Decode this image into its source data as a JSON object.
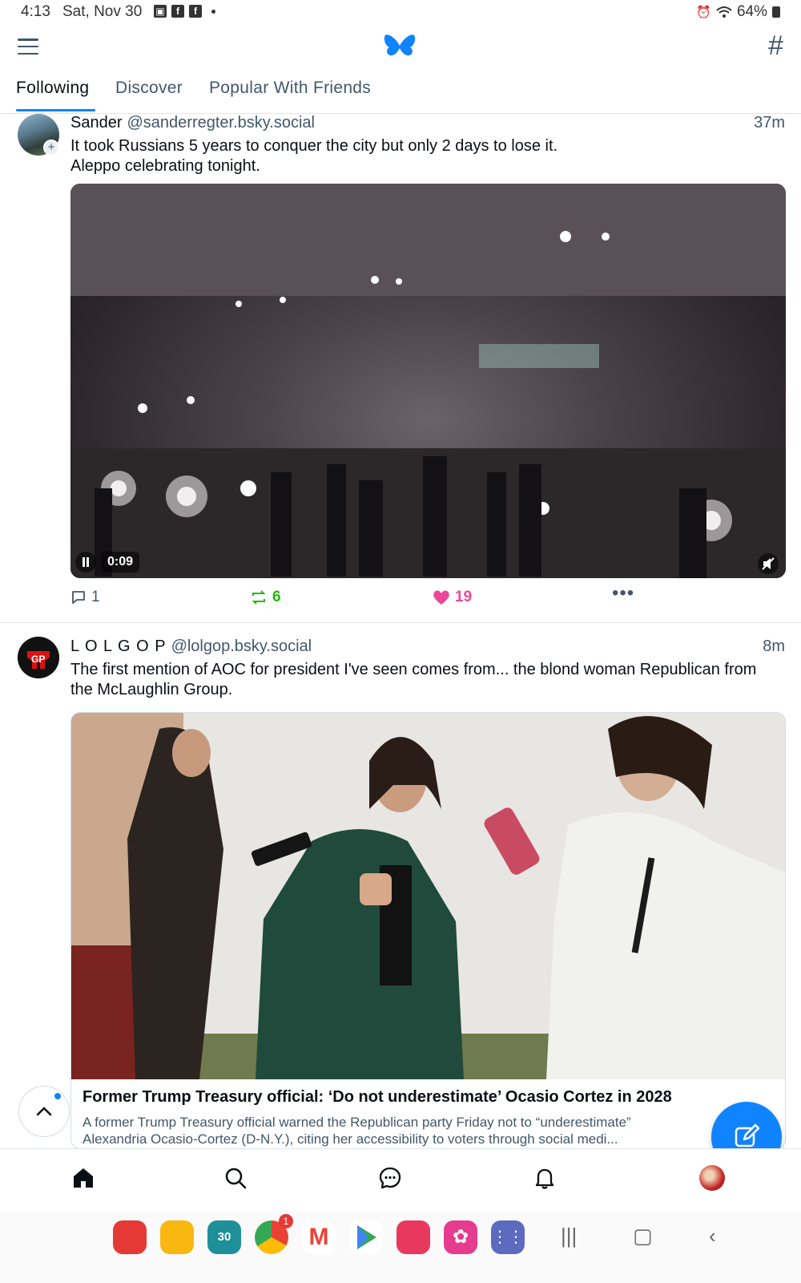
{
  "status_bar": {
    "time": "4:13",
    "date": "Sat, Nov 30",
    "battery": "64%",
    "app_icons": [
      "gallery-icon",
      "facebook-icon",
      "facebook-icon"
    ]
  },
  "header": {
    "logo_icon": "butterfly-icon",
    "menu_icon": "hamburger-menu-icon",
    "feeds_icon": "hashtag-icon"
  },
  "tabs": [
    {
      "label": "Following",
      "active": true
    },
    {
      "label": "Discover",
      "active": false
    },
    {
      "label": "Popular With Friends",
      "active": false
    }
  ],
  "posts": [
    {
      "author_name": "Sander",
      "author_handle": "@sanderregter.bsky.social",
      "time": "37m",
      "text": "It took Russians 5 years to conquer the city but only 2 days to lose it.\nAleppo celebrating tonight.",
      "video_time": "0:09",
      "replies": "1",
      "reposts": "6",
      "likes": "19"
    },
    {
      "author_name": "L O L G O P",
      "author_handle": "@lolgop.bsky.social",
      "time": "8m",
      "text": "The first mention of AOC for president I've seen comes from... the blond woman Republican from the McLaughlin Group.",
      "link_title": "Former Trump Treasury official: ‘Do not underestimate’ Ocasio Cortez in 2028",
      "link_desc_line1": "A former Trump Treasury official warned the Republican party Friday not to “underestimate”",
      "link_desc_line2": "Alexandria Ocasio-Cortez (D-N.Y.), citing her accessibility to voters through social medi..."
    }
  ],
  "bottom_nav": [
    "home-icon",
    "search-icon",
    "chat-icon",
    "bell-icon",
    "profile-avatar"
  ],
  "dock": {
    "calendar_day": "30",
    "chrome_badge": "1"
  },
  "colors": {
    "accent": "#1083fe",
    "repost": "#20bc07",
    "like": "#ec4899",
    "muted": "#42576c"
  }
}
